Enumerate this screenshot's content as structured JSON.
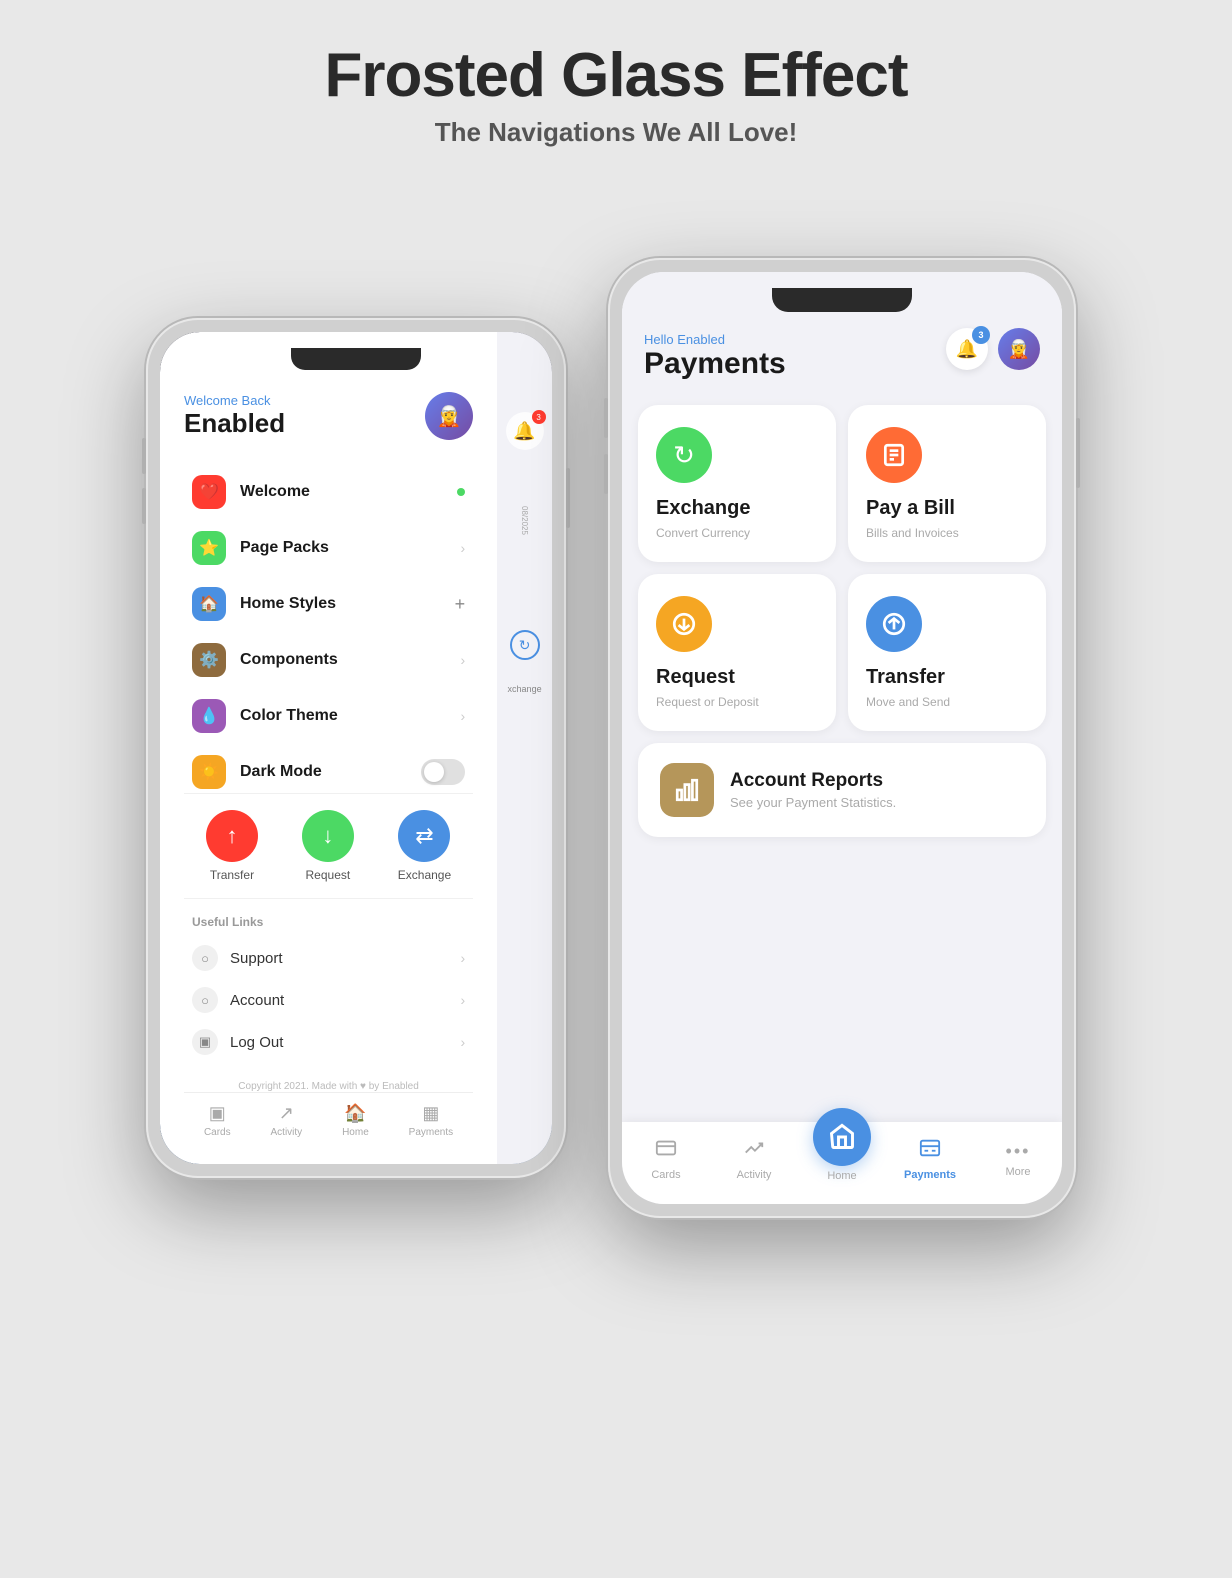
{
  "header": {
    "title": "Frosted Glass Effect",
    "subtitle": "The Navigations We All Love!"
  },
  "left_phone": {
    "welcome_text": "Welcome Back",
    "username": "Enabled",
    "menu_items": [
      {
        "label": "Welcome",
        "icon": "❤️",
        "icon_bg": "#ff3b30",
        "suffix": "dot"
      },
      {
        "label": "Page Packs",
        "icon": "⭐",
        "icon_bg": "#4cd964",
        "suffix": "chevron"
      },
      {
        "label": "Home Styles",
        "icon": "🏠",
        "icon_bg": "#4a90e2",
        "suffix": "plus"
      },
      {
        "label": "Components",
        "icon": "⚙️",
        "icon_bg": "#8e6b3e",
        "suffix": "chevron"
      },
      {
        "label": "Color Theme",
        "icon": "💧",
        "icon_bg": "#9b59b6",
        "suffix": "chevron"
      },
      {
        "label": "Dark Mode",
        "icon": "☀️",
        "icon_bg": "#f5a623",
        "suffix": "toggle"
      }
    ],
    "actions": [
      {
        "label": "Transfer",
        "icon": "↑",
        "bg": "#ff3b30"
      },
      {
        "label": "Request",
        "icon": "↓",
        "bg": "#4cd964"
      },
      {
        "label": "Exchange",
        "icon": "⇄",
        "bg": "#4a90e2"
      }
    ],
    "useful_links_title": "Useful Links",
    "links": [
      {
        "label": "Support",
        "icon": "○"
      },
      {
        "label": "Account",
        "icon": "○"
      },
      {
        "label": "Log Out",
        "icon": "▣"
      }
    ],
    "footer": "Copyright 2021. Made with ♥ by Enabled",
    "tabs": [
      {
        "label": "Cards",
        "icon": "▣"
      },
      {
        "label": "Activity",
        "icon": "↗"
      },
      {
        "label": "Home",
        "icon": "🏠"
      },
      {
        "label": "Payments",
        "icon": "▦"
      }
    ]
  },
  "right_phone": {
    "greeting": "Hello Enabled",
    "title": "Payments",
    "notification_count": "3",
    "payment_cards": [
      {
        "name": "Exchange",
        "desc": "Convert Currency",
        "icon": "↻",
        "icon_bg": "#4cd964"
      },
      {
        "name": "Pay a Bill",
        "desc": "Bills and Invoices",
        "icon": "▦",
        "icon_bg": "#ff6b35"
      },
      {
        "name": "Request",
        "desc": "Request or Deposit",
        "icon": "↓",
        "icon_bg": "#f5a623"
      },
      {
        "name": "Transfer",
        "desc": "Move and Send",
        "icon": "↑",
        "icon_bg": "#4a90e2"
      }
    ],
    "account_reports": {
      "name": "Account Reports",
      "desc": "See your Payment Statistics.",
      "icon": "▣",
      "icon_bg": "#b5965a"
    },
    "tabs": [
      {
        "label": "Cards",
        "icon": "▣",
        "active": false
      },
      {
        "label": "Activity",
        "icon": "↗",
        "active": false
      },
      {
        "label": "Home",
        "icon": "🏠",
        "active": false,
        "is_home": true
      },
      {
        "label": "Payments",
        "icon": "▦",
        "active": true
      },
      {
        "label": "More",
        "icon": "•••",
        "active": false
      }
    ]
  }
}
